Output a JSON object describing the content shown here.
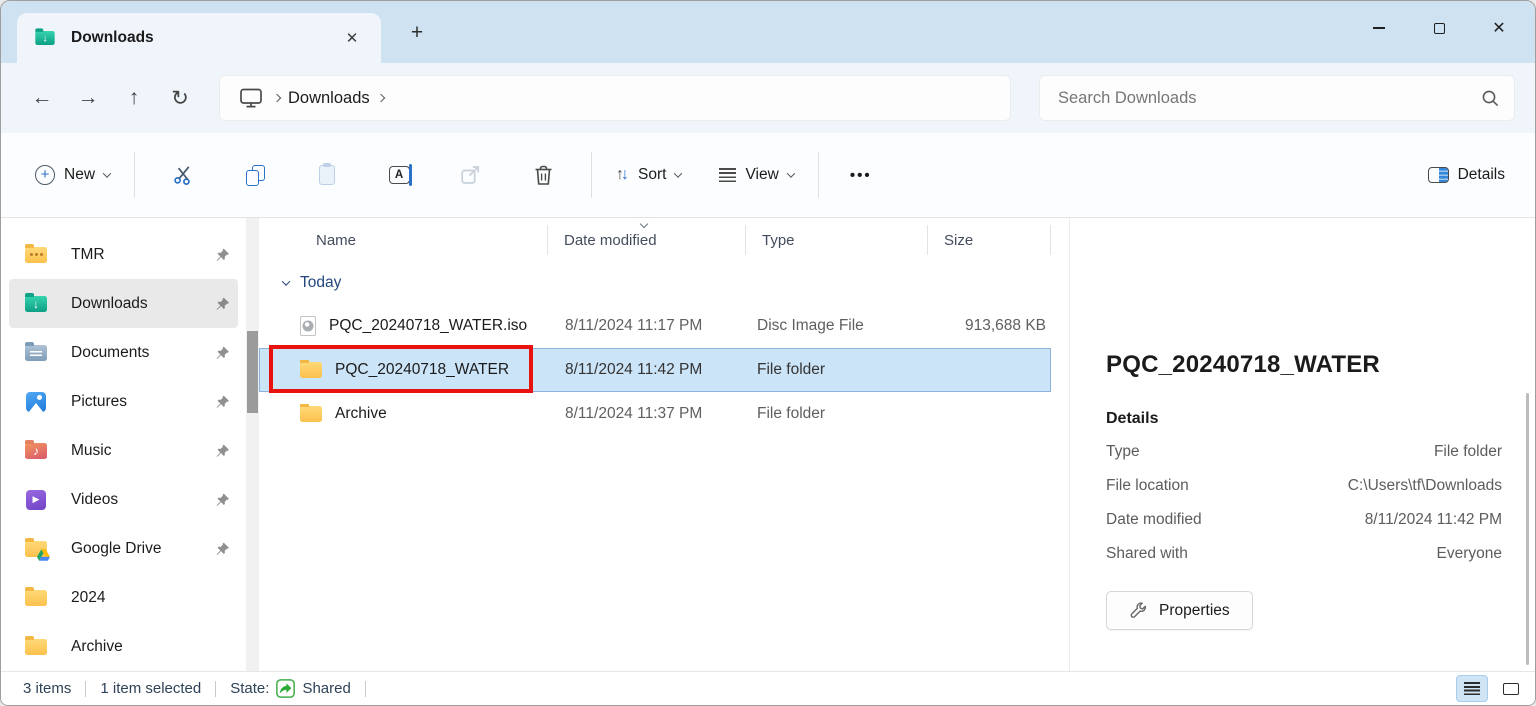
{
  "window": {
    "tab_title": "Downloads"
  },
  "icons": {
    "plus": "+",
    "close": "✕",
    "back": "←",
    "forward": "→",
    "up": "↑",
    "refresh": "↻",
    "more": "•••",
    "sort_up": "↑",
    "sort_down": "↓",
    "rename_letter": "A",
    "download_arrow": "↓",
    "music_note": "♪",
    "play": "▶"
  },
  "nav": {
    "location": "Downloads",
    "search_placeholder": "Search Downloads"
  },
  "toolbar": {
    "new_label": "New",
    "sort_label": "Sort",
    "view_label": "View",
    "details_label": "Details"
  },
  "sidebar": {
    "items": [
      {
        "label": "TMR",
        "pinned": true
      },
      {
        "label": "Downloads",
        "pinned": true,
        "selected": true
      },
      {
        "label": "Documents",
        "pinned": true
      },
      {
        "label": "Pictures",
        "pinned": true
      },
      {
        "label": "Music",
        "pinned": true
      },
      {
        "label": "Videos",
        "pinned": true
      },
      {
        "label": "Google Drive",
        "pinned": true
      },
      {
        "label": "2024",
        "pinned": false
      },
      {
        "label": "Archive",
        "pinned": false
      }
    ]
  },
  "files": {
    "columns": [
      "Name",
      "Date modified",
      "Type",
      "Size"
    ],
    "group_label": "Today",
    "rows": [
      {
        "name": "PQC_20240718_WATER.iso",
        "date_modified": "8/11/2024 11:17 PM",
        "type": "Disc Image File",
        "size": "913,688 KB",
        "selected": false
      },
      {
        "name": "PQC_20240718_WATER",
        "date_modified": "8/11/2024 11:42 PM",
        "type": "File folder",
        "size": "",
        "selected": true
      },
      {
        "name": "Archive",
        "date_modified": "8/11/2024 11:37 PM",
        "type": "File folder",
        "size": "",
        "selected": false
      }
    ]
  },
  "details_pane": {
    "title": "PQC_20240718_WATER",
    "heading": "Details",
    "rows": [
      {
        "label": "Type",
        "value": "File folder"
      },
      {
        "label": "File location",
        "value": "C:\\Users\\tf\\Downloads"
      },
      {
        "label": "Date modified",
        "value": "8/11/2024 11:42 PM"
      },
      {
        "label": "Shared with",
        "value": "Everyone"
      }
    ],
    "properties_label": "Properties"
  },
  "status_bar": {
    "items_count": "3 items",
    "selected_count": "1 item selected",
    "state_label": "State:",
    "state_value": "Shared"
  }
}
